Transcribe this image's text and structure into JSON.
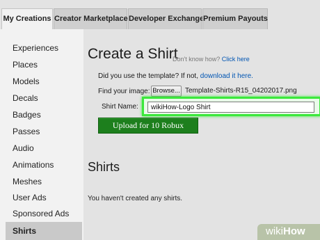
{
  "tabs": [
    {
      "label": "My Creations",
      "active": true
    },
    {
      "label": "Creator Marketplace",
      "active": false
    },
    {
      "label": "Developer Exchange",
      "active": false
    },
    {
      "label": "Premium Payouts",
      "active": false
    }
  ],
  "sidebar": {
    "items": [
      {
        "label": "Experiences"
      },
      {
        "label": "Places"
      },
      {
        "label": "Models"
      },
      {
        "label": "Decals"
      },
      {
        "label": "Badges"
      },
      {
        "label": "Passes"
      },
      {
        "label": "Audio"
      },
      {
        "label": "Animations"
      },
      {
        "label": "Meshes"
      },
      {
        "label": "User Ads"
      },
      {
        "label": "Sponsored Ads"
      },
      {
        "label": "Shirts",
        "selected": true
      }
    ]
  },
  "create": {
    "title": "Create a Shirt",
    "help_prefix": "Don't know how?",
    "help_link": "Click here",
    "template_question": "Did you use the template? If not,",
    "template_link": "download it here.",
    "find_label": "Find your image:",
    "browse_label": "Browse...",
    "file_name": "Template-Shirts-R15_04202017.png",
    "name_label": "Shirt Name:",
    "name_value": "wikiHow-Logo Shirt",
    "upload_label": "Upload for 10 Robux"
  },
  "shirts": {
    "title": "Shirts",
    "empty_message": "You haven't created any shirts."
  },
  "watermark": {
    "prefix": "wiki",
    "suffix": "How"
  },
  "colors": {
    "highlight": "#3ce83c",
    "upload_button": "#1d7f1d",
    "link": "#0055b3"
  }
}
